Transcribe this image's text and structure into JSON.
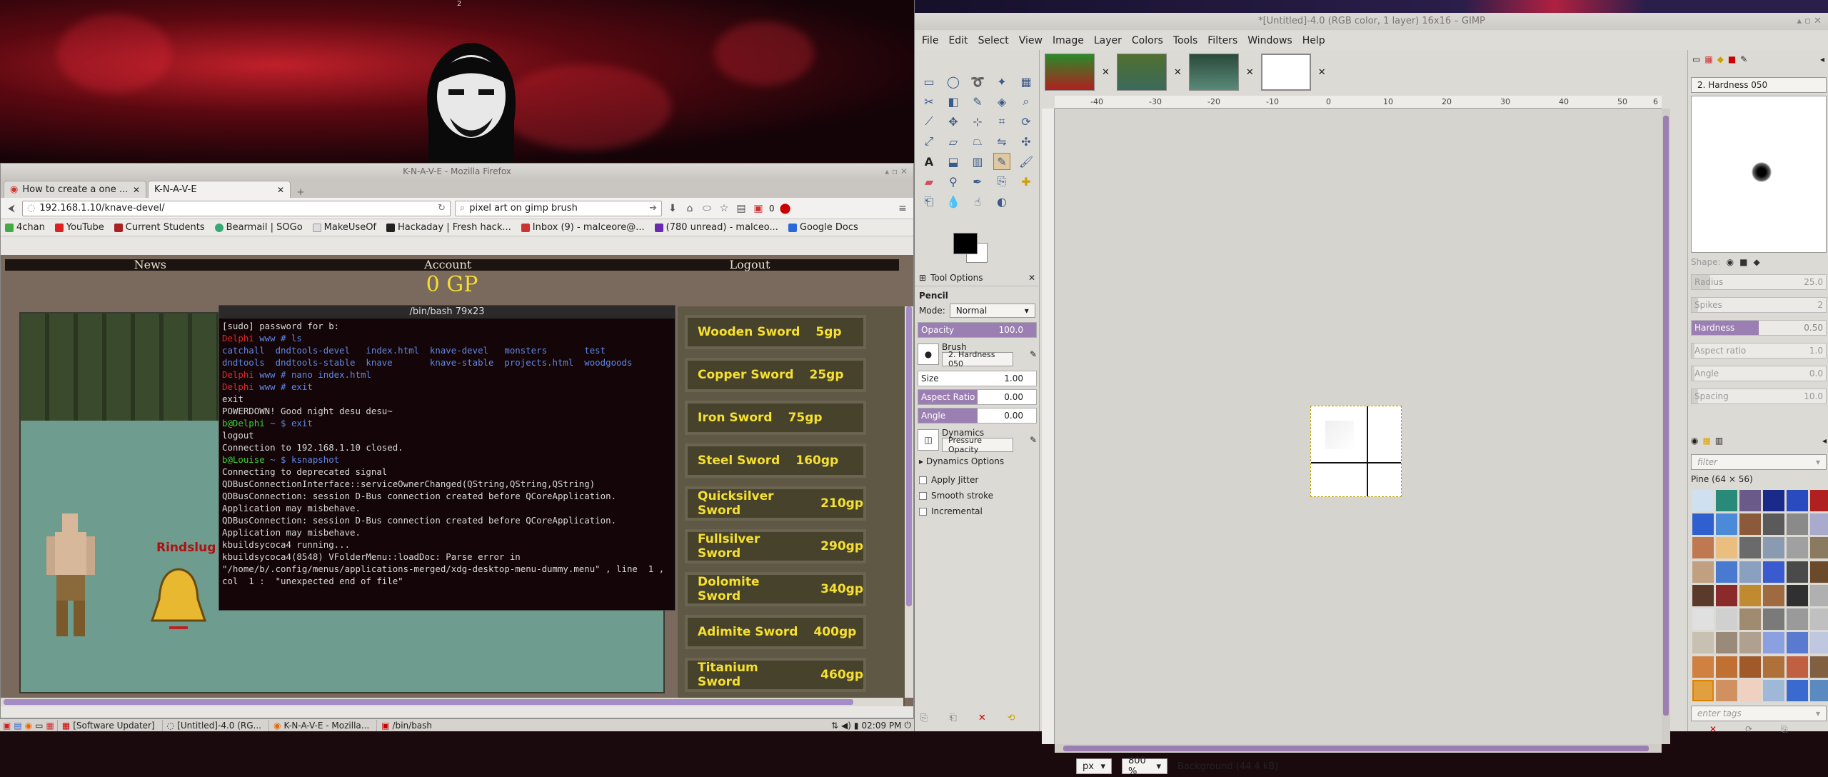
{
  "wallpaper": {
    "workspace_number": "2"
  },
  "firefox": {
    "title": "K-N-A-V-E - Mozilla Firefox",
    "tabs": [
      {
        "label": "How to create a one ..."
      },
      {
        "label": "K-N-A-V-E"
      }
    ],
    "url": "192.168.1.10/knave-devel/",
    "search": "pixel art on gimp brush",
    "download_count": "0",
    "bookmarks": [
      "4chan",
      "YouTube",
      "Current Students",
      "Bearmail | SOGo",
      "MakeUseOf",
      "Hackaday | Fresh hack...",
      "Inbox (9) - malceore@...",
      "(780 unread) - malceo...",
      "Google Docs"
    ],
    "game": {
      "nav": [
        "News",
        "Account",
        "Logout"
      ],
      "gold": "0 GP",
      "npc_name": "Rindslug",
      "shop": [
        {
          "name": "Wooden Sword",
          "price": "5gp"
        },
        {
          "name": "Copper Sword",
          "price": "25gp"
        },
        {
          "name": "Iron Sword",
          "price": "75gp"
        },
        {
          "name": "Steel Sword",
          "price": "160gp"
        },
        {
          "name": "Quicksilver Sword",
          "price": "210gp"
        },
        {
          "name": "Fullsilver Sword",
          "price": "290gp"
        },
        {
          "name": "Dolomite Sword",
          "price": "340gp"
        },
        {
          "name": "Adimite Sword",
          "price": "400gp"
        },
        {
          "name": "Titanium Sword",
          "price": "460gp"
        }
      ]
    }
  },
  "terminal": {
    "title": "/bin/bash 79x23",
    "lines": [
      {
        "parts": [
          {
            "t": "[sudo] password for b:",
            "c": ""
          }
        ]
      },
      {
        "parts": [
          {
            "t": "Delphi ",
            "c": "r"
          },
          {
            "t": "www # ls",
            "c": "b"
          }
        ]
      },
      {
        "parts": [
          {
            "t": "catchall  dndtools-devel   index.html  knave-devel   monsters       test",
            "c": "b"
          }
        ]
      },
      {
        "parts": [
          {
            "t": "dndtools  dndtools-stable  knave       knave-stable  projects.html  woodgoods",
            "c": "b"
          }
        ]
      },
      {
        "parts": [
          {
            "t": "Delphi ",
            "c": "r"
          },
          {
            "t": "www # nano index.html",
            "c": "b"
          }
        ]
      },
      {
        "parts": [
          {
            "t": "Delphi ",
            "c": "r"
          },
          {
            "t": "www # exit",
            "c": "b"
          }
        ]
      },
      {
        "parts": [
          {
            "t": "exit",
            "c": ""
          }
        ]
      },
      {
        "parts": [
          {
            "t": "POWERDOWN! Good night desu desu~",
            "c": ""
          }
        ]
      },
      {
        "parts": [
          {
            "t": "b@Delphi ",
            "c": "g"
          },
          {
            "t": "~ $ exit",
            "c": "b"
          }
        ]
      },
      {
        "parts": [
          {
            "t": "logout",
            "c": ""
          }
        ]
      },
      {
        "parts": [
          {
            "t": "Connection to 192.168.1.10 closed.",
            "c": ""
          }
        ]
      },
      {
        "parts": [
          {
            "t": "b@Louise ",
            "c": "g"
          },
          {
            "t": "~ $ ksnapshot",
            "c": "b"
          }
        ]
      },
      {
        "parts": [
          {
            "t": "Connecting to deprecated signal QDBusConnectionInterface::serviceOwnerChanged(QString,QString,QString)",
            "c": ""
          }
        ]
      },
      {
        "parts": [
          {
            "t": "QDBusConnection: session D-Bus connection created before QCoreApplication. Application may misbehave.",
            "c": ""
          }
        ]
      },
      {
        "parts": [
          {
            "t": "QDBusConnection: session D-Bus connection created before QCoreApplication. Application may misbehave.",
            "c": ""
          }
        ]
      },
      {
        "parts": [
          {
            "t": "kbuildsycoca4 running...",
            "c": ""
          }
        ]
      },
      {
        "parts": [
          {
            "t": "kbuildsycoca4(8548) VFolderMenu::loadDoc: Parse error in  \"/home/b/.config/menus/applications-merged/xdg-desktop-menu-dummy.menu\" , line  1 , col  1 :  \"unexpected end of file\"",
            "c": ""
          }
        ]
      }
    ]
  },
  "taskbar": {
    "items": [
      "[Software Updater]",
      "[Untitled]-4.0 (RG...",
      "K-N-A-V-E - Mozilla...",
      "/bin/bash"
    ],
    "clock": "02:09 PM"
  },
  "gimp": {
    "title": "*[Untitled]-4.0 (RGB color, 1 layer) 16x16 – GIMP",
    "menu": [
      "File",
      "Edit",
      "Select",
      "View",
      "Image",
      "Layer",
      "Colors",
      "Tools",
      "Filters",
      "Windows",
      "Help"
    ],
    "tool_options": {
      "tab": "Tool Options",
      "tool": "Pencil",
      "mode_label": "Mode:",
      "mode": "Normal",
      "opacity_label": "Opacity",
      "opacity": "100.0",
      "brush_label": "Brush",
      "brush": "2. Hardness 050",
      "size_label": "Size",
      "size": "1.00",
      "aspect_label": "Aspect Ratio",
      "aspect": "0.00",
      "angle_label": "Angle",
      "angle": "0.00",
      "dynamics_label": "Dynamics",
      "dynamics": "Pressure Opacity",
      "dynamics_options": "Dynamics Options",
      "checks": [
        "Apply Jitter",
        "Smooth stroke",
        "Incremental"
      ]
    },
    "ruler_ticks": [
      "-40",
      "-30",
      "-20",
      "-10",
      "0",
      "10",
      "20",
      "30",
      "40",
      "50",
      "6"
    ],
    "status": {
      "unit": "px",
      "zoom": "800 %",
      "layer": "Background (44.4 kB)"
    },
    "brushes": {
      "name": "2. Hardness 050",
      "shape_label": "Shape:",
      "params": [
        {
          "label": "Radius",
          "value": "25.0"
        },
        {
          "label": "Spikes",
          "value": "2"
        },
        {
          "label": "Hardness",
          "value": "0.50"
        },
        {
          "label": "Aspect ratio",
          "value": "1.0"
        },
        {
          "label": "Angle",
          "value": "0.0"
        },
        {
          "label": "Spacing",
          "value": "10.0"
        }
      ],
      "filter_placeholder": "filter",
      "pattern_name": "Pine (64 × 56)",
      "tags_placeholder": "enter tags"
    }
  }
}
